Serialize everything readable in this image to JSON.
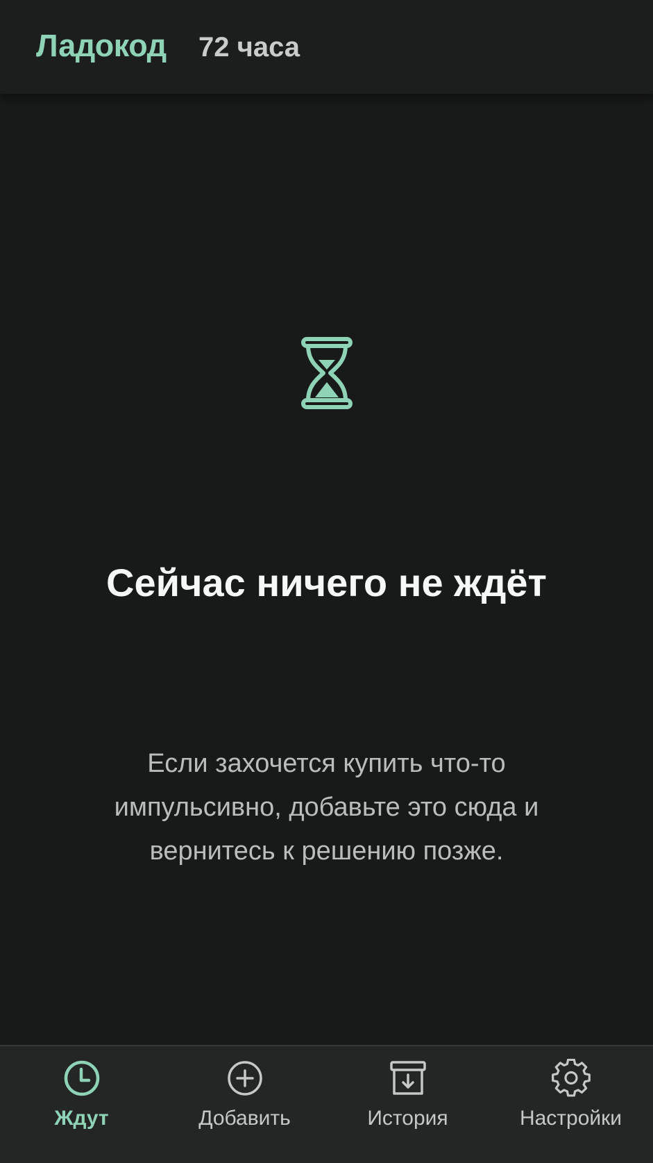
{
  "header": {
    "brand": "Ладокод",
    "subtitle": "72 часа"
  },
  "empty_state": {
    "icon": "hourglass-icon",
    "title": "Сейчас ничего не ждёт",
    "description": "Если захочется купить что-то импульсивно, добавьте это сюда и вернитесь к решению позже."
  },
  "tabs": [
    {
      "label": "Ждут",
      "icon": "clock-icon",
      "active": true
    },
    {
      "label": "Добавить",
      "icon": "plus-circle-icon",
      "active": false
    },
    {
      "label": "История",
      "icon": "archive-icon",
      "active": false
    },
    {
      "label": "Настройки",
      "icon": "gear-icon",
      "active": false
    }
  ],
  "colors": {
    "accent": "#8fd3b6",
    "background": "#181a19",
    "header": "#1c1e1d",
    "tabbar": "#232624"
  }
}
